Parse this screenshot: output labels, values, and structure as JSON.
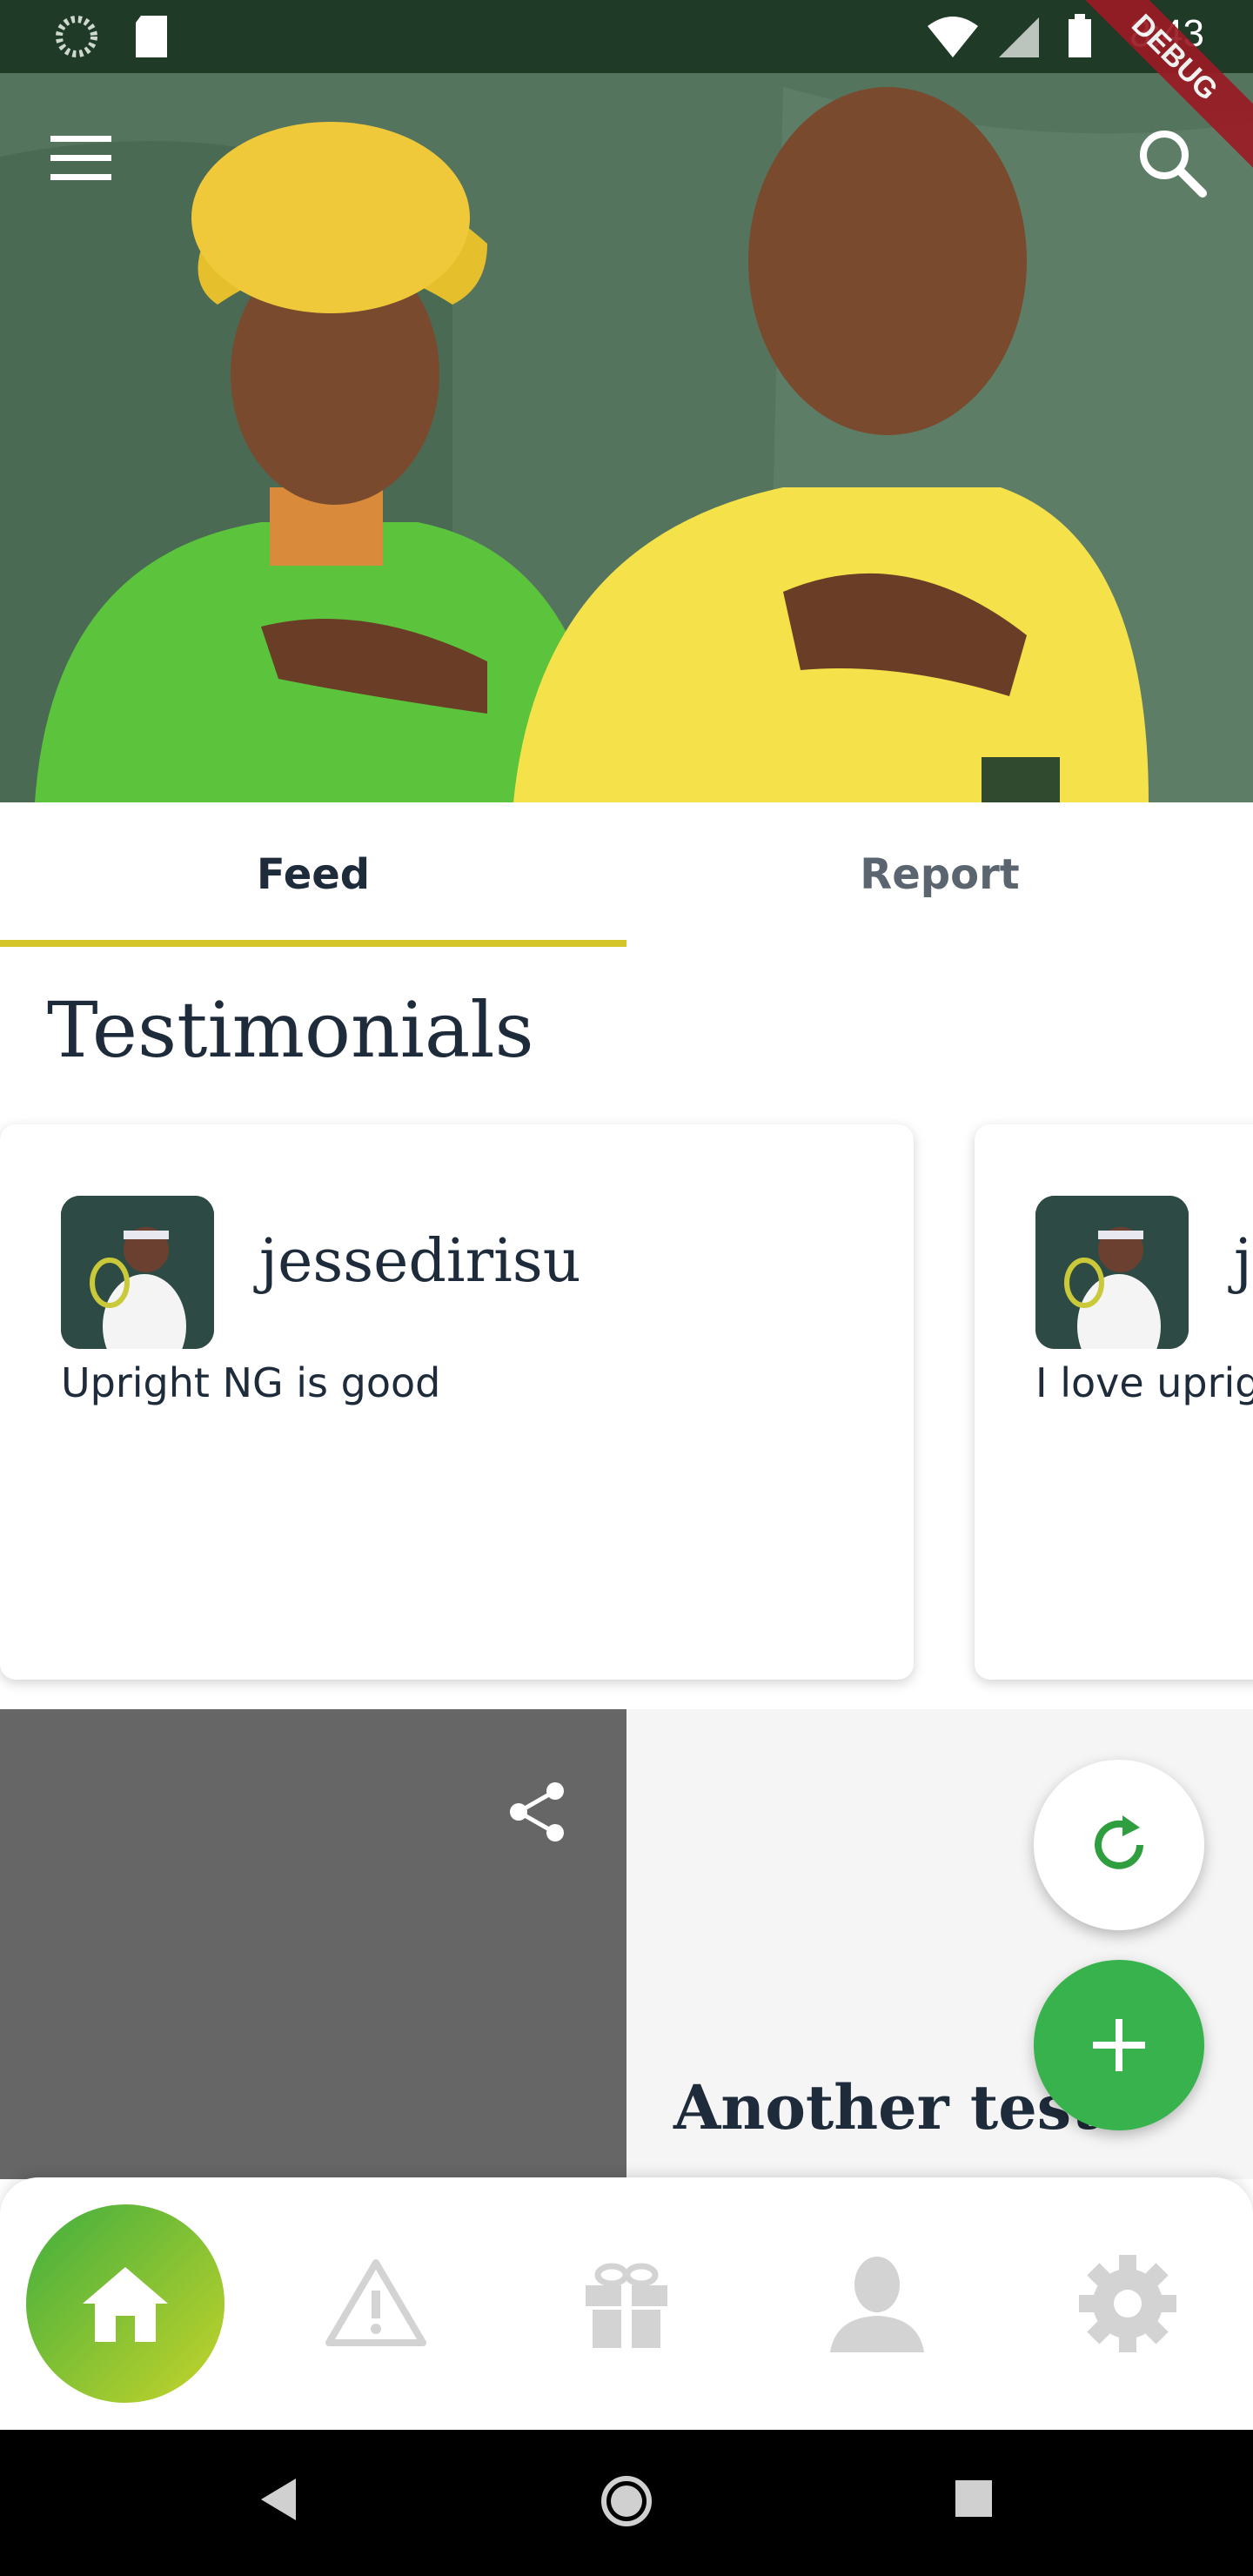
{
  "status_bar": {
    "time": "8:43",
    "debug_label": "DEBUG"
  },
  "tabs": [
    {
      "label": "Feed",
      "active": true
    },
    {
      "label": "Report",
      "active": false
    }
  ],
  "section_title": "Testimonials",
  "testimonials": [
    {
      "username": "jessedirisu",
      "text": "Upright NG is good"
    },
    {
      "username": "j",
      "text": "I love uprig"
    }
  ],
  "tiles": [
    {
      "title": ""
    },
    {
      "title": "Another test"
    }
  ],
  "icons": {
    "menu": "menu-icon",
    "search": "search-icon",
    "share": "share-icon",
    "refresh": "refresh-icon",
    "add": "plus-icon",
    "nav": [
      "home-icon",
      "warning-icon",
      "gift-icon",
      "person-icon",
      "gear-icon"
    ]
  },
  "colors": {
    "accent_green": "#37b24d",
    "tab_indicator": "#d3c52a",
    "text_dark": "#1e2b3a",
    "hero_bg": "#55745e",
    "debug_ribbon": "#9b1b24"
  }
}
